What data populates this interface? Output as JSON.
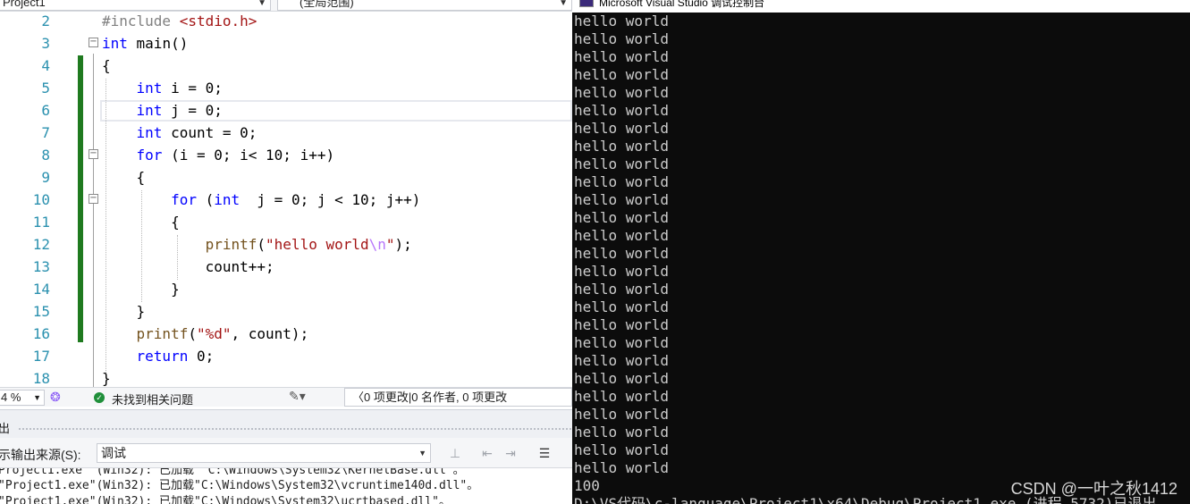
{
  "nav": {
    "project": "Project1",
    "scope": "(全局范围)"
  },
  "editor": {
    "lines": [
      {
        "num": "2",
        "code": [
          {
            "t": "#include ",
            "c": "pp"
          },
          {
            "t": "<stdio.h>",
            "c": "inc"
          }
        ]
      },
      {
        "num": "3",
        "code": [
          {
            "t": "int",
            "c": "kw"
          },
          {
            "t": " main()",
            "c": ""
          }
        ]
      },
      {
        "num": "4",
        "code": [
          {
            "t": "{",
            "c": ""
          }
        ]
      },
      {
        "num": "5",
        "code": [
          {
            "t": "    ",
            "c": ""
          },
          {
            "t": "int",
            "c": "kw"
          },
          {
            "t": " i = 0;",
            "c": ""
          }
        ]
      },
      {
        "num": "6",
        "code": [
          {
            "t": "    ",
            "c": ""
          },
          {
            "t": "int",
            "c": "kw"
          },
          {
            "t": " j = 0;",
            "c": ""
          }
        ]
      },
      {
        "num": "7",
        "code": [
          {
            "t": "    ",
            "c": ""
          },
          {
            "t": "int",
            "c": "kw"
          },
          {
            "t": " count = 0;",
            "c": ""
          }
        ]
      },
      {
        "num": "8",
        "code": [
          {
            "t": "    ",
            "c": ""
          },
          {
            "t": "for",
            "c": "kw"
          },
          {
            "t": " (i = 0; i< 10; i++)",
            "c": ""
          }
        ]
      },
      {
        "num": "9",
        "code": [
          {
            "t": "    {",
            "c": ""
          }
        ]
      },
      {
        "num": "10",
        "code": [
          {
            "t": "        ",
            "c": ""
          },
          {
            "t": "for",
            "c": "kw"
          },
          {
            "t": " (",
            "c": ""
          },
          {
            "t": "int",
            "c": "kw"
          },
          {
            "t": "  j = 0; j < 10; j++)",
            "c": ""
          }
        ]
      },
      {
        "num": "11",
        "code": [
          {
            "t": "        {",
            "c": ""
          }
        ]
      },
      {
        "num": "12",
        "code": [
          {
            "t": "            ",
            "c": ""
          },
          {
            "t": "printf",
            "c": "fn"
          },
          {
            "t": "(",
            "c": ""
          },
          {
            "t": "\"hello world",
            "c": "str"
          },
          {
            "t": "\\n",
            "c": "esc"
          },
          {
            "t": "\"",
            "c": "str"
          },
          {
            "t": ");",
            "c": ""
          }
        ]
      },
      {
        "num": "13",
        "code": [
          {
            "t": "            count++;",
            "c": ""
          }
        ]
      },
      {
        "num": "14",
        "code": [
          {
            "t": "        }",
            "c": ""
          }
        ]
      },
      {
        "num": "15",
        "code": [
          {
            "t": "    }",
            "c": ""
          }
        ]
      },
      {
        "num": "16",
        "code": [
          {
            "t": "    ",
            "c": ""
          },
          {
            "t": "printf",
            "c": "fn"
          },
          {
            "t": "(",
            "c": ""
          },
          {
            "t": "\"%d\"",
            "c": "str"
          },
          {
            "t": ", count);",
            "c": ""
          }
        ]
      },
      {
        "num": "17",
        "code": [
          {
            "t": "    ",
            "c": ""
          },
          {
            "t": "return",
            "c": "kw"
          },
          {
            "t": " 0;",
            "c": ""
          }
        ]
      },
      {
        "num": "18",
        "code": [
          {
            "t": "}",
            "c": ""
          }
        ]
      }
    ]
  },
  "status": {
    "zoom": "4 %",
    "health": "未找到相关问题",
    "changes": "〈0 项更改|0 名作者, 0 项更改"
  },
  "output": {
    "title": "出",
    "source_label": "示输出来源(S):",
    "source_value": "调试",
    "lines": [
      "Project1.exe\" (Win32): 已加载 \"C:\\Windows\\System32\\KernelBase.dll\"。",
      "\"Project1.exe\"(Win32): 已加载\"C:\\Windows\\System32\\vcruntime140d.dll\"。",
      "\"Project1.exe\"(Win32): 已加载\"C:\\Windows\\System32\\ucrtbased.dll\"。"
    ]
  },
  "console": {
    "title": "Microsoft Visual Studio 调试控制台",
    "hello_line": "hello world",
    "hello_count": 26,
    "result": "100",
    "exit_line": "D:\\VS代码\\c-language\\Project1\\x64\\Debug\\Project1.exe (进程 5732)已退出",
    "watermark": "CSDN @一叶之秋1412"
  }
}
